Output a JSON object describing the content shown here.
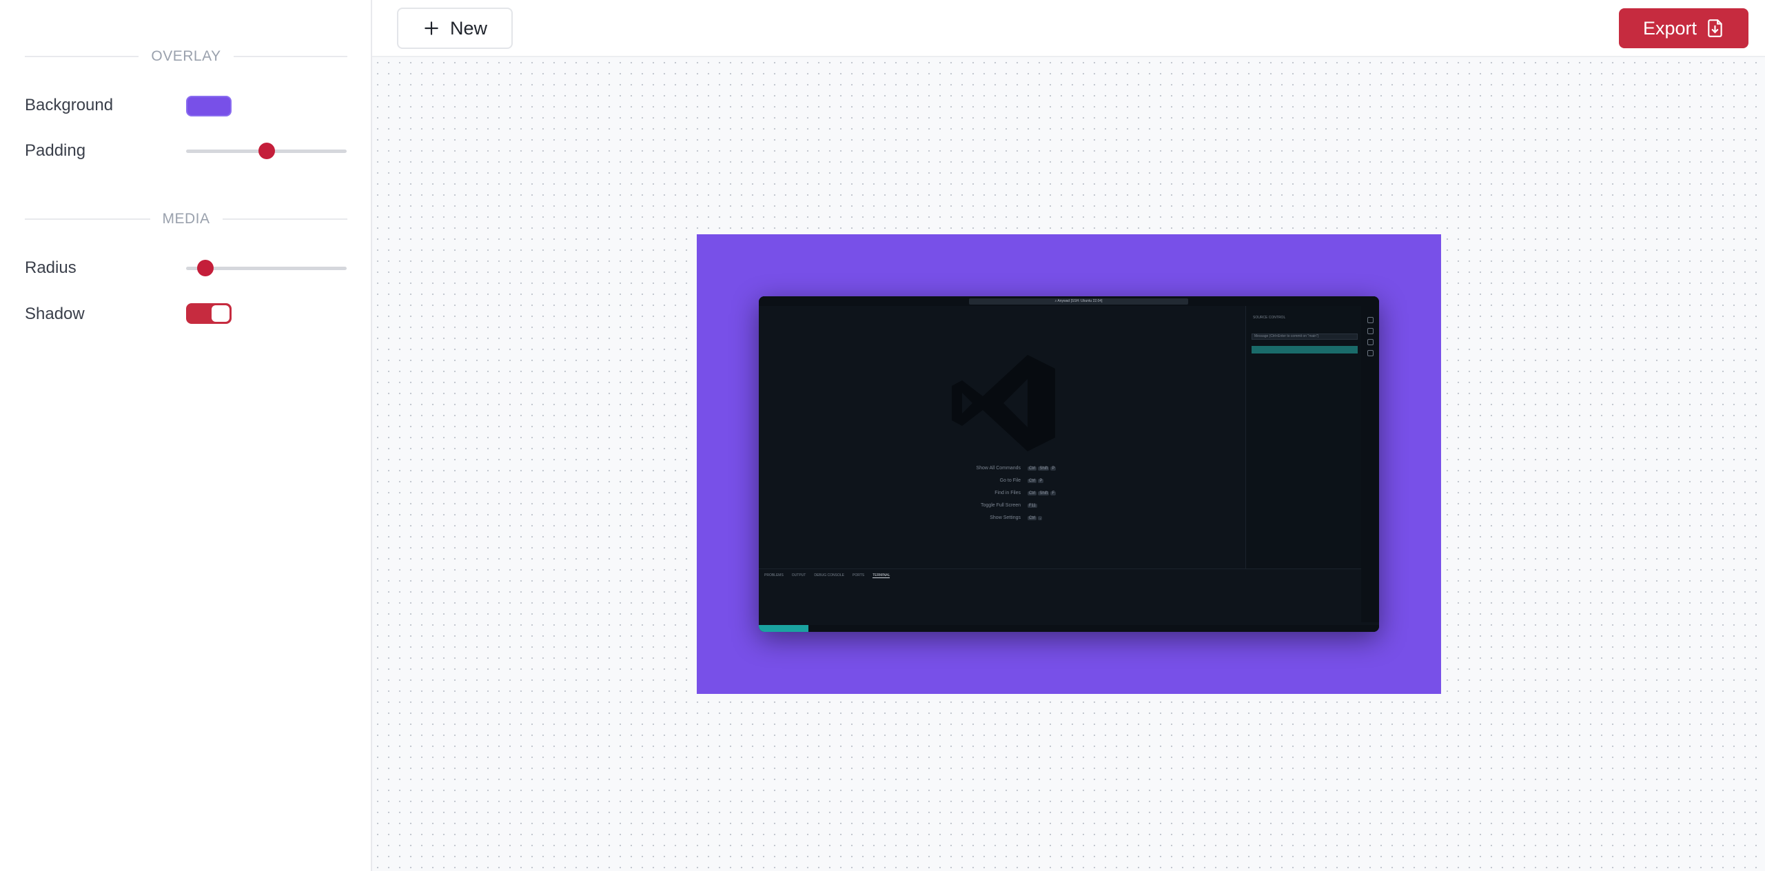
{
  "sidebar": {
    "overlay": {
      "title": "OVERLAY",
      "background_label": "Background",
      "background_color": "#7850E8",
      "padding_label": "Padding",
      "padding_value": 0.5
    },
    "media": {
      "title": "MEDIA",
      "radius_label": "Radius",
      "radius_value": 0.12,
      "shadow_label": "Shadow",
      "shadow_enabled": true
    }
  },
  "toolbar": {
    "new_label": "New",
    "new_icon": "plus-icon",
    "export_label": "Export",
    "export_icon": "file-export-icon"
  },
  "colors": {
    "accent": "#C62B3F",
    "frame_background": "#7850E8",
    "canvas_dot": "#C3C7CF"
  },
  "preview": {
    "title_search": "⌕ Anywad [SSH: Ubuntu 22.04]",
    "commands": [
      {
        "label": "Show All Commands",
        "keys": [
          "Ctrl",
          "Shift",
          "P"
        ]
      },
      {
        "label": "Go to File",
        "keys": [
          "Ctrl",
          "P"
        ]
      },
      {
        "label": "Find in Files",
        "keys": [
          "Ctrl",
          "Shift",
          "F"
        ]
      },
      {
        "label": "Toggle Full Screen",
        "keys": [
          "F11"
        ]
      },
      {
        "label": "Show Settings",
        "keys": [
          "Ctrl",
          ","
        ]
      }
    ],
    "scm_title": "SOURCE CONTROL",
    "scm_message": "Message (Ctrl+Enter to commit on \"main\")",
    "panel_tabs": [
      "PROBLEMS",
      "OUTPUT",
      "DEBUG CONSOLE",
      "PORTS",
      "TERMINAL"
    ],
    "status_remote": "SSH: Ubuntu 22.04"
  }
}
